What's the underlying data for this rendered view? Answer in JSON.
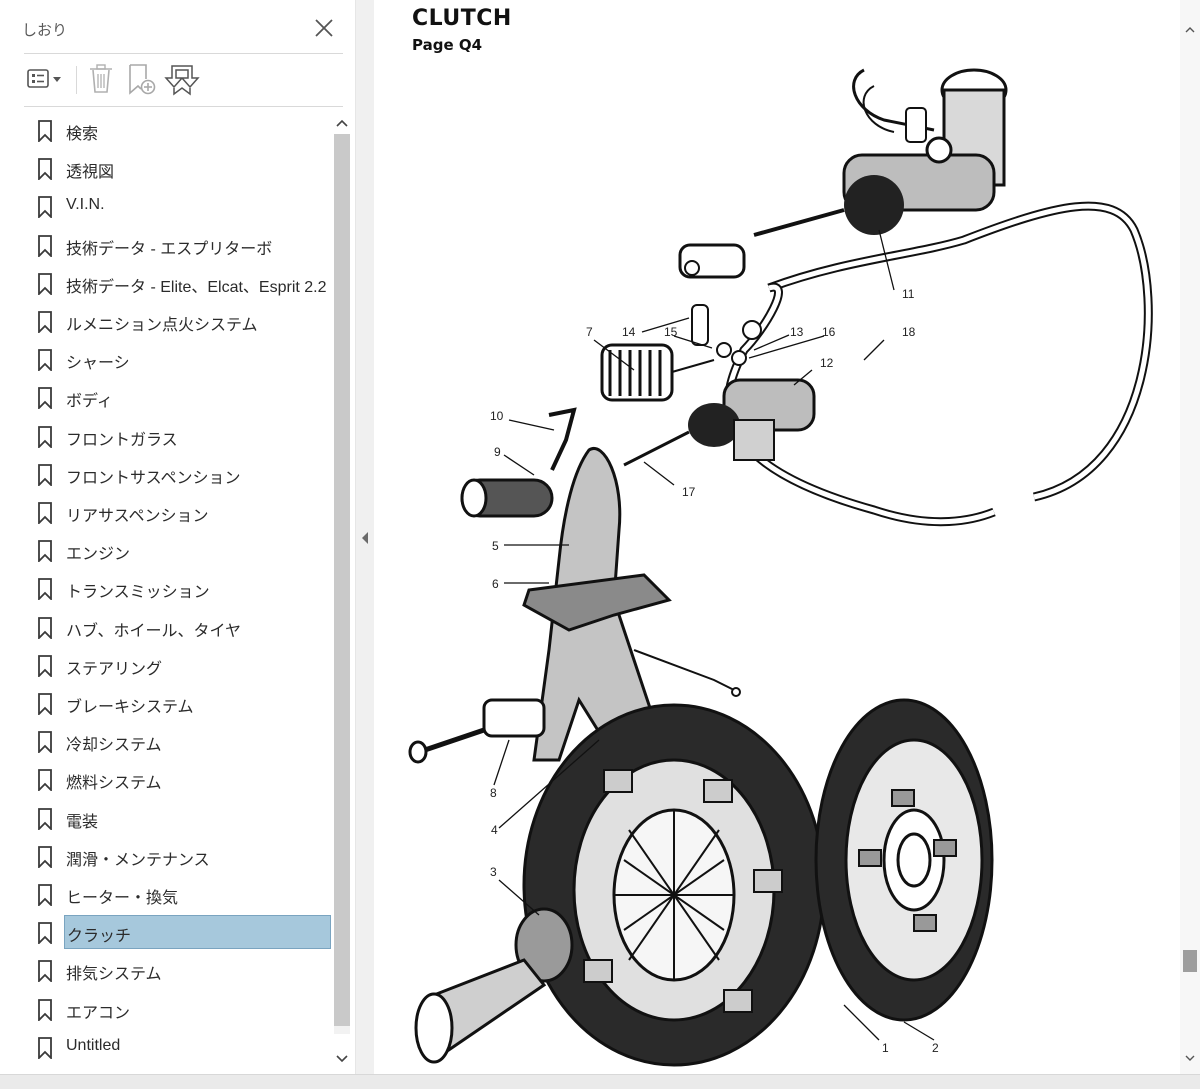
{
  "panel": {
    "title": "しおり",
    "toolbar": {
      "options_icon": "options-menu-icon",
      "delete_icon": "trash-icon",
      "new_bookmark_icon": "new-bookmark-icon",
      "expand_icon": "expand-bookmark-icon"
    },
    "items": [
      {
        "label": "検索"
      },
      {
        "label": "透視図"
      },
      {
        "label": "V.I.N."
      },
      {
        "label": "技術データ - エスプリターボ"
      },
      {
        "label": "技術データ - Elite、Elcat、Esprit 2.2"
      },
      {
        "label": "ルメニション点火システム"
      },
      {
        "label": "シャーシ"
      },
      {
        "label": "ボディ"
      },
      {
        "label": "フロントガラス"
      },
      {
        "label": "フロントサスペンション"
      },
      {
        "label": "リアサスペンション"
      },
      {
        "label": "エンジン"
      },
      {
        "label": "トランスミッション"
      },
      {
        "label": "ハブ、ホイール、タイヤ"
      },
      {
        "label": "ステアリング"
      },
      {
        "label": "ブレーキシステム"
      },
      {
        "label": "冷却システム"
      },
      {
        "label": "燃料システム"
      },
      {
        "label": "電装"
      },
      {
        "label": "潤滑・メンテナンス"
      },
      {
        "label": "ヒーター・換気"
      },
      {
        "label": "クラッチ",
        "selected": true
      },
      {
        "label": "排気システム"
      },
      {
        "label": "エアコン"
      },
      {
        "label": "Untitled"
      }
    ],
    "selected_color": "#a6c8dc"
  },
  "document": {
    "title": "CLUTCH",
    "subtitle": "Page Q4",
    "callouts": [
      "1",
      "2",
      "3",
      "4",
      "5",
      "6",
      "7",
      "8",
      "9",
      "10",
      "11",
      "12",
      "13",
      "14",
      "15",
      "16",
      "17",
      "18"
    ]
  }
}
